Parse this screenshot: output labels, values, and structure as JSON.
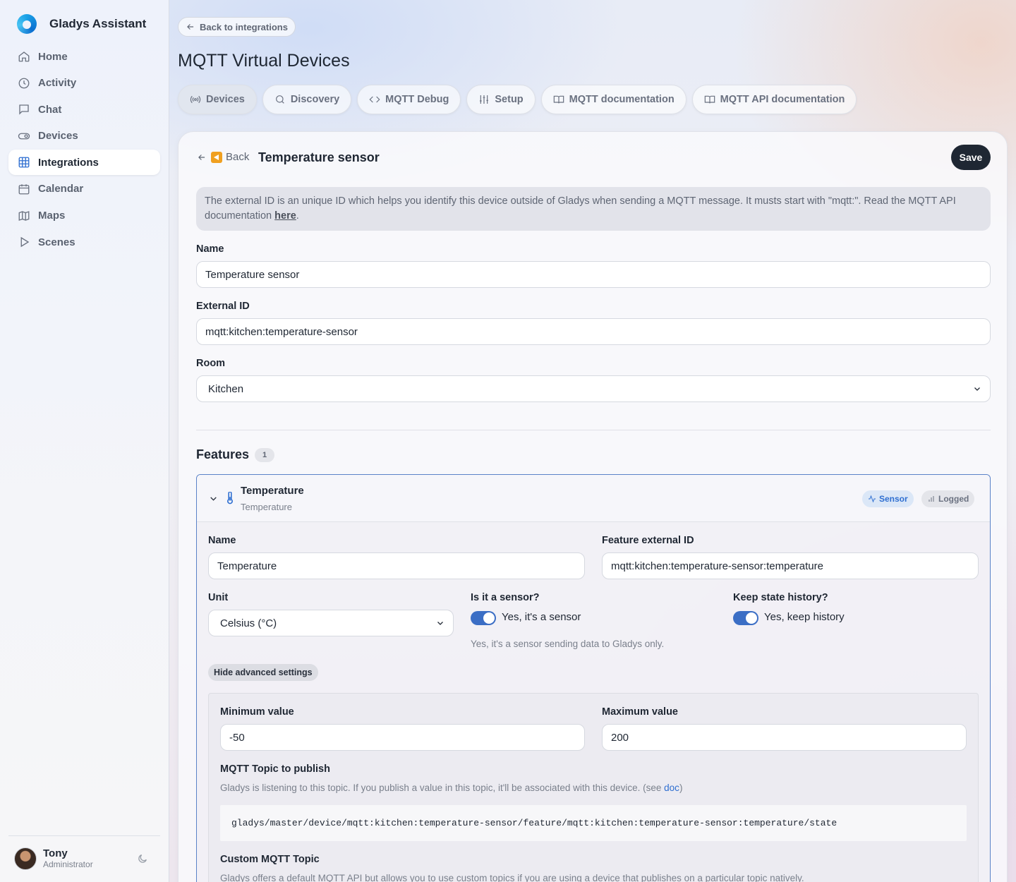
{
  "app": {
    "name": "Gladys Assistant"
  },
  "sidebar": {
    "items": [
      {
        "label": "Home",
        "icon": "home-icon"
      },
      {
        "label": "Activity",
        "icon": "clock-icon"
      },
      {
        "label": "Chat",
        "icon": "chat-icon"
      },
      {
        "label": "Devices",
        "icon": "toggle-icon"
      },
      {
        "label": "Integrations",
        "icon": "grid-icon",
        "active": true
      },
      {
        "label": "Calendar",
        "icon": "calendar-icon"
      },
      {
        "label": "Maps",
        "icon": "map-icon"
      },
      {
        "label": "Scenes",
        "icon": "play-icon"
      }
    ],
    "user": {
      "name": "Tony",
      "role": "Administrator"
    }
  },
  "header": {
    "back_label": "Back to integrations",
    "title": "MQTT Virtual Devices",
    "tabs": [
      {
        "label": "Devices",
        "icon": "broadcast-icon",
        "active": true
      },
      {
        "label": "Discovery",
        "icon": "search-icon"
      },
      {
        "label": "MQTT Debug",
        "icon": "code-icon"
      },
      {
        "label": "Setup",
        "icon": "sliders-icon"
      },
      {
        "label": "MQTT documentation",
        "icon": "book-icon"
      },
      {
        "label": "MQTT API documentation",
        "icon": "book-icon"
      }
    ]
  },
  "device": {
    "back_label": "Back",
    "title": "Temperature sensor",
    "save_label": "Save",
    "info_text": "The external ID is an unique ID which helps you identify this device outside of Gladys when sending a MQTT message. It musts start with \"mqtt:\". Read the MQTT API documentation ",
    "info_link": "here",
    "info_end": ".",
    "name_label": "Name",
    "name_value": "Temperature sensor",
    "external_id_label": "External ID",
    "external_id_value": "mqtt:kitchen:temperature-sensor",
    "room_label": "Room",
    "room_value": "Kitchen"
  },
  "features": {
    "title": "Features",
    "count": "1",
    "items": [
      {
        "name": "Temperature",
        "subtitle": "Temperature",
        "badges": {
          "sensor": "Sensor",
          "logged": "Logged"
        },
        "name_label": "Name",
        "name_value": "Temperature",
        "ext_id_label": "Feature external ID",
        "ext_id_value": "mqtt:kitchen:temperature-sensor:temperature",
        "unit_label": "Unit",
        "unit_value": "Celsius (°C)",
        "sensor_label": "Is it a sensor?",
        "sensor_toggle_label": "Yes, it's a sensor",
        "sensor_helper": "Yes, it's a sensor sending data to Gladys only.",
        "history_label": "Keep state history?",
        "history_toggle_label": "Yes, keep history",
        "advanced_button": "Hide advanced settings",
        "min_label": "Minimum value",
        "min_value": "-50",
        "max_label": "Maximum value",
        "max_value": "200",
        "topic_label": "MQTT Topic to publish",
        "topic_helper": "Gladys is listening to this topic. If you publish a value in this topic, it'll be associated with this device. (see ",
        "topic_helper_link": "doc",
        "topic_helper_end": ")",
        "topic_value": "gladys/master/device/mqtt:kitchen:temperature-sensor/feature/mqtt:kitchen:temperature-sensor:temperature/state",
        "custom_topic_label": "Custom MQTT Topic",
        "custom_topic_helper": "Gladys offers a default MQTT API but allows you to use custom topics if you are using a device that publishes on a particular topic natively."
      }
    ]
  },
  "colors": {
    "accent": "#2f6fd1",
    "dark": "#1f2733",
    "toggle": "#3b6ec5"
  }
}
